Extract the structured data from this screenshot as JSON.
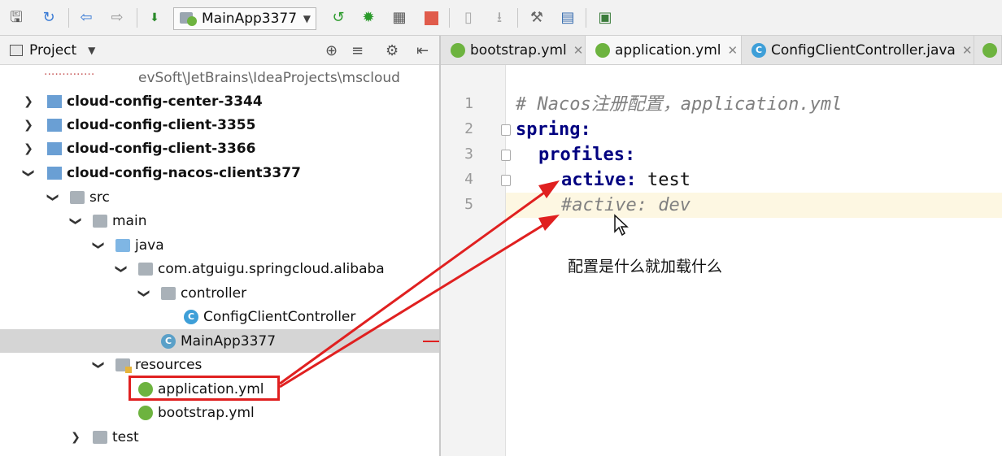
{
  "toolbar": {
    "run_config_label": "MainApp3377"
  },
  "project_panel": {
    "title": "Project",
    "path_fragment": "evSoft\\JetBrains\\IdeaProjects\\mscloud",
    "tree": [
      {
        "label": "cloud-config-center-3344",
        "bold": true
      },
      {
        "label": "cloud-config-client-3355",
        "bold": true
      },
      {
        "label": "cloud-config-client-3366",
        "bold": true
      },
      {
        "label": "cloud-config-nacos-client3377",
        "bold": true
      },
      {
        "label": "src"
      },
      {
        "label": "main"
      },
      {
        "label": "java"
      },
      {
        "label": "com.atguigu.springcloud.alibaba"
      },
      {
        "label": "controller"
      },
      {
        "label": "ConfigClientController"
      },
      {
        "label": "MainApp3377",
        "selected": true
      },
      {
        "label": "resources"
      },
      {
        "label": "application.yml",
        "highlighted": true
      },
      {
        "label": "bootstrap.yml"
      },
      {
        "label": "test"
      }
    ]
  },
  "editor": {
    "tabs": [
      {
        "label": "bootstrap.yml",
        "icon": "spring-icon",
        "active": false
      },
      {
        "label": "application.yml",
        "icon": "spring-icon",
        "active": true
      },
      {
        "label": "ConfigClientController.java",
        "icon": "java-class-icon",
        "active": false
      }
    ],
    "lines": [
      {
        "number": "1",
        "text": "# Nacos注册配置，application.yml"
      },
      {
        "number": "2",
        "key": "spring",
        "value": ""
      },
      {
        "number": "3",
        "key": "profiles",
        "value": ""
      },
      {
        "number": "4",
        "key": "active",
        "value": "test"
      },
      {
        "number": "5",
        "text": "#active: dev"
      }
    ],
    "annotation": "配置是什么就加载什么"
  },
  "colors": {
    "annotation_red": "#e02020",
    "yaml_key": "#000080",
    "comment": "#808080"
  }
}
